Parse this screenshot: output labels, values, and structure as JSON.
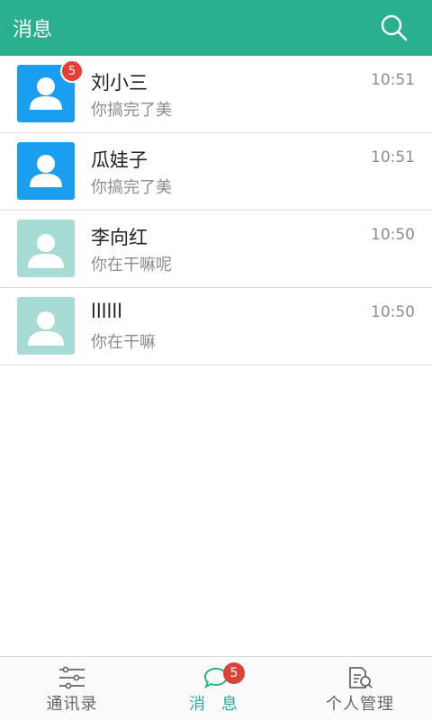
{
  "header": {
    "title": "消息",
    "search_icon": "search-icon"
  },
  "colors": {
    "accent": "#2aaf8f",
    "badge": "#e83c36",
    "avatar_blue": "#1a9ff0",
    "avatar_teal": "#a6dcd4"
  },
  "messages": [
    {
      "name": "刘小三",
      "preview": "你搞完了美",
      "time": "10:51",
      "avatar": "blue",
      "badge": "5"
    },
    {
      "name": "瓜娃子",
      "preview": "你搞完了美",
      "time": "10:51",
      "avatar": "blue",
      "badge": ""
    },
    {
      "name": "李向红",
      "preview": "你在干嘛呢",
      "time": "10:50",
      "avatar": "teal",
      "badge": ""
    },
    {
      "name": "llllll",
      "preview": "你在干嘛",
      "time": "10:50",
      "avatar": "teal",
      "badge": ""
    }
  ],
  "tabs": [
    {
      "label": "通讯录",
      "icon": "contacts-list-icon"
    },
    {
      "label": "消 息",
      "icon": "chat-bubble-icon",
      "badge": "5"
    },
    {
      "label": "个人管理",
      "icon": "profile-document-icon"
    }
  ]
}
